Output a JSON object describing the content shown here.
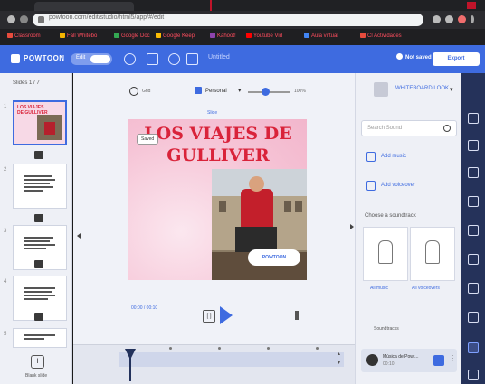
{
  "browser": {
    "url": "powtoon.com/edit/studio/html5/app/#/edit"
  },
  "bookmarks": [
    {
      "label": "Classroom"
    },
    {
      "label": "Fall Whitebo"
    },
    {
      "label": "Google Doc"
    },
    {
      "label": "Google Keep"
    },
    {
      "label": "Kahoot!"
    },
    {
      "label": "Youtube Vid"
    },
    {
      "label": "Aula virtual"
    },
    {
      "label": "Cl Actividades"
    }
  ],
  "toolbar": {
    "logo": "POWTOON",
    "mode": "Edit",
    "document_title": "Untitled",
    "save_status": "Not saved",
    "publish_label": "Export",
    "accent": "#3e6be0"
  },
  "slides_panel": {
    "header": "Slides 1 / 7",
    "add_label": "Blank slide",
    "slides": [
      {
        "num": "1",
        "title": "LOS VIAJES DE GULLIVER"
      },
      {
        "num": "2"
      },
      {
        "num": "3"
      },
      {
        "num": "4"
      },
      {
        "num": "5"
      },
      {
        "num": "6"
      }
    ]
  },
  "canvas_controls": {
    "toggle_label": "Grid",
    "preset_label": "Personal",
    "zoom": "100%",
    "tag": "Slide"
  },
  "slide": {
    "title": "LOS VIAJES DE GULLIVER",
    "tooltip": "Saved",
    "badge": "POWTOON",
    "colors": {
      "title": "#d9233a",
      "background": "#f8d7e4"
    }
  },
  "playback": {
    "time": "00:00 / 00:10"
  },
  "right_panel": {
    "title": "WHITEBOARD LOOK",
    "search_placeholder": "Search Sound",
    "add_music": "Add music",
    "add_voiceover": "Add voiceover",
    "section": "Choose a soundtrack",
    "cards": [
      {
        "label": "All music"
      },
      {
        "label": "All voiceovers"
      }
    ],
    "more": "Soundtracks",
    "audio_title": "Música de Powt...",
    "audio_length": "00:10"
  },
  "rail": {
    "icons": [
      "scenes-icon",
      "background-icon",
      "text-icon",
      "props-icon",
      "characters-icon",
      "effects-icon",
      "shapes-icon",
      "media-icon",
      "music-icon",
      "upload-icon"
    ],
    "active": "music-icon"
  }
}
